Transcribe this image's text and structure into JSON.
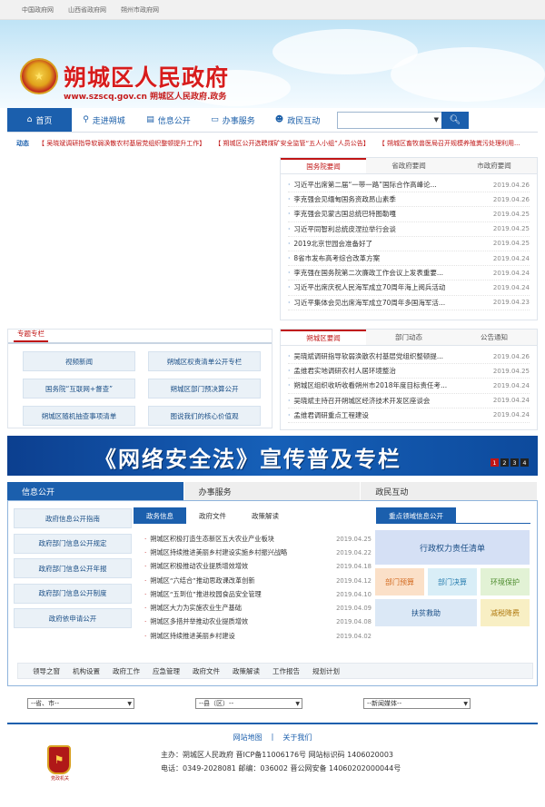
{
  "topbar": {
    "links": [
      "中国政府网",
      "山西省政府网",
      "朔州市政府网"
    ]
  },
  "header": {
    "title": "朔城区人民政府",
    "url": "www.szscq.gov.cn 朔城区人民政府.政务",
    "emblem_icon": "national-emblem-icon"
  },
  "nav": {
    "items": [
      {
        "label": "首页",
        "icon": "home-icon"
      },
      {
        "label": "走进朔城",
        "icon": "location-icon"
      },
      {
        "label": "信息公开",
        "icon": "document-icon"
      },
      {
        "label": "办事服务",
        "icon": "monitor-icon"
      },
      {
        "label": "政民互动",
        "icon": "people-icon"
      }
    ],
    "search_placeholder": "",
    "search_icon": "search-icon"
  },
  "ticker": {
    "label": "动态",
    "items": [
      "【 吴晓斌调研指导软弱涣散农村基层党组织整顿提升工作】",
      "【 朔城区公开选聘煤矿安全监管“五人小组”人员公告】",
      "【 朔城区畜牧兽医局召开规模养殖粪污处理利用..."
    ]
  },
  "news_panel": {
    "tabs": [
      "国务院要闻",
      "省政府要闻",
      "市政府要闻"
    ],
    "items": [
      {
        "title": "习近平出席第二届“一带一路”国际合作高峰论...",
        "date": "2019.04.26"
      },
      {
        "title": "李克强会见缅甸国务资政昂山素季",
        "date": "2019.04.26"
      },
      {
        "title": "李克强会见蒙古国总统巴特图勒嘎",
        "date": "2019.04.25"
      },
      {
        "title": "习近平同智利总统皮涅拉举行会谈",
        "date": "2019.04.25"
      },
      {
        "title": "2019北京世园会准备好了",
        "date": "2019.04.25"
      },
      {
        "title": "8省市发布高考综合改革方案",
        "date": "2019.04.24"
      },
      {
        "title": "李克强在国务院第二次廉政工作会议上发表重要...",
        "date": "2019.04.24"
      },
      {
        "title": "习近平出席庆祝人民海军成立70周年海上阅兵活动",
        "date": "2019.04.24"
      },
      {
        "title": "习近平集体会见出席海军成立70周年多国海军活...",
        "date": "2019.04.23"
      }
    ]
  },
  "special": {
    "title": "专题专栏",
    "items": [
      "视频新闻",
      "朔城区权责清单公开专栏",
      "国务院“互联网+督查”",
      "朔城区部门预决算公开",
      "朔城区随机抽查事项清单",
      "图说我们的核心价值观"
    ]
  },
  "local_panel": {
    "tabs": [
      "朔城区要闻",
      "部门动态",
      "公告通知"
    ],
    "items": [
      {
        "title": "吴晓斌调研指导软弱涣散农村基层党组织整顿提...",
        "date": "2019.04.26"
      },
      {
        "title": "孟维君实地调研农村人居环境整治",
        "date": "2019.04.25"
      },
      {
        "title": "朔城区组织收听收看朔州市2018年度目标责任考...",
        "date": "2019.04.24"
      },
      {
        "title": "吴晓斌主持召开朔城区经济技术开发区座谈会",
        "date": "2019.04.24"
      },
      {
        "title": "孟维君调研重点工程建设",
        "date": "2019.04.24"
      }
    ]
  },
  "banner": {
    "text": "《网络安全法》宣传普及专栏",
    "pages": [
      "1",
      "2",
      "3",
      "4"
    ]
  },
  "bottom": {
    "tabs": [
      "信息公开",
      "办事服务",
      "政民互动"
    ],
    "left_links": [
      "政府信息公开指南",
      "政府部门信息公开规定",
      "政府部门信息公开年报",
      "政府部门信息公开制度",
      "政府依申请公开"
    ],
    "mid_tabs": [
      "政务信息",
      "政府文件",
      "政策解读"
    ],
    "mid_items": [
      {
        "title": "朔城区积极打造生态新区五大农业产业板块",
        "date": "2019.04.25"
      },
      {
        "title": "朔城区持续推进美丽乡村建设实施乡村振兴战略",
        "date": "2019.04.22"
      },
      {
        "title": "朔城区积极推动农业提质增效增效",
        "date": "2019.04.18"
      },
      {
        "title": "朔城区“六结合”推动思政课改革创新",
        "date": "2019.04.12"
      },
      {
        "title": "朔城区“五到位”推进校园食品安全管理",
        "date": "2019.04.10"
      },
      {
        "title": "朔城区大力为实施农业生产基础",
        "date": "2019.04.09"
      },
      {
        "title": "朔城区多措并举推动农业提质增效",
        "date": "2019.04.08"
      },
      {
        "title": "朔城区持续推进美丽乡村建设",
        "date": "2019.04.02"
      }
    ],
    "right_title": "重点领域信息公开",
    "tiles": [
      "行政权力责任清单",
      "部门预算",
      "部门决算",
      "环境保护",
      "扶贫救助",
      "减税降费"
    ],
    "subnav": [
      "领导之窗",
      "机构设置",
      "政府工作",
      "应急管理",
      "政府文件",
      "政策解读",
      "工作报告",
      "规划计划"
    ]
  },
  "selects": [
    "--省、市--",
    "--县（区）--",
    "--新闻媒体--"
  ],
  "footer": {
    "links": [
      "网站地图",
      "|",
      "关于我们"
    ],
    "line1": "主办：朔城区人民政府  晋ICP备11006176号 网站标识码 1406020003",
    "line2": "电话：0349-2028081 邮编：036002 晋公网安备 14060202000044号",
    "badge_caption": "党政机关"
  },
  "colors": {
    "primary": "#1b5fad",
    "accent_red": "#c01515"
  }
}
